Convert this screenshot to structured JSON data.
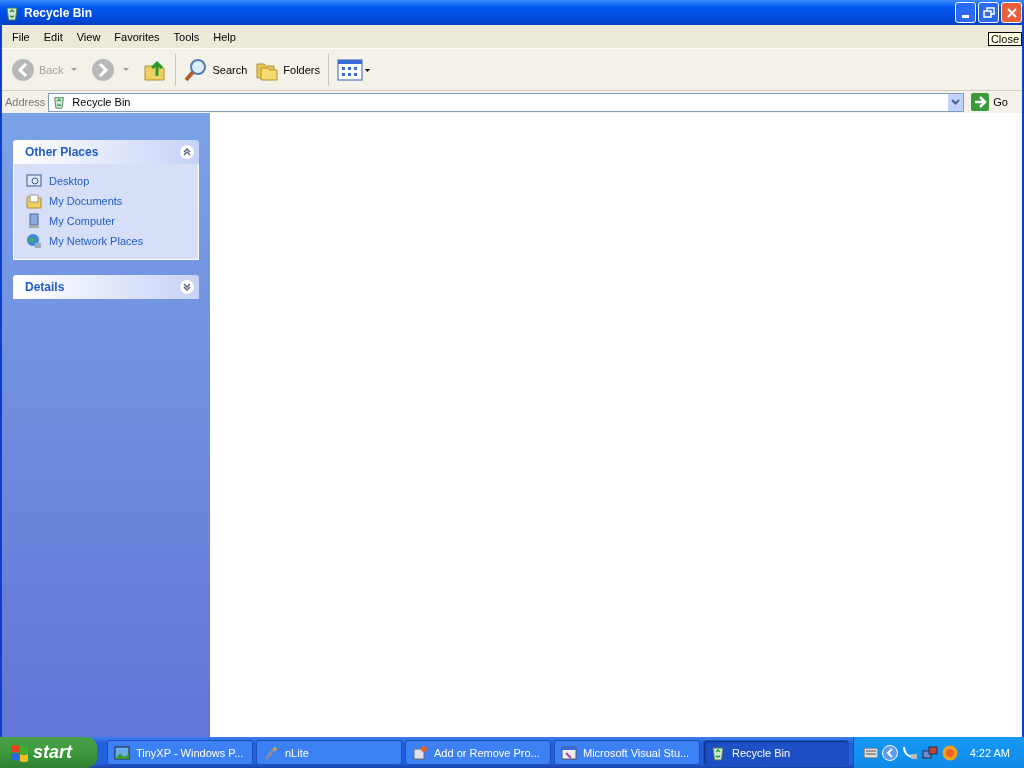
{
  "window": {
    "title": "Recycle Bin"
  },
  "tooltip": "Close",
  "menu": [
    "File",
    "Edit",
    "View",
    "Favorites",
    "Tools",
    "Help"
  ],
  "toolbar": [
    {
      "kind": "back",
      "label": "Back",
      "disabled": true
    },
    {
      "kind": "forward",
      "disabled": true
    },
    {
      "kind": "up",
      "disabled": false
    },
    {
      "kind": "search",
      "label": "Search",
      "disabled": false
    },
    {
      "kind": "folders",
      "label": "Folders",
      "disabled": false
    },
    {
      "kind": "views",
      "disabled": false
    }
  ],
  "address": {
    "label": "Address",
    "value": "Recycle Bin",
    "go": "Go"
  },
  "sidebar": [
    {
      "title": "Other Places",
      "expanded": true,
      "items": [
        {
          "kind": "desktop",
          "label": "Desktop"
        },
        {
          "kind": "documents",
          "label": "My Documents"
        },
        {
          "kind": "computer",
          "label": "My Computer"
        },
        {
          "kind": "network",
          "label": "My Network Places"
        }
      ]
    },
    {
      "title": "Details",
      "expanded": false
    }
  ],
  "taskbar": {
    "start": "start",
    "tasks": [
      {
        "kind": "picture",
        "label": "TinyXP - Windows P...",
        "selected": false
      },
      {
        "kind": "tool",
        "label": "nLite",
        "selected": false
      },
      {
        "kind": "programs",
        "label": "Add or Remove Pro...",
        "selected": false
      },
      {
        "kind": "studio",
        "label": "Microsoft Visual Stu...",
        "selected": false
      },
      {
        "kind": "bin",
        "label": "Recycle Bin",
        "selected": true
      }
    ],
    "clock": "4:22 AM"
  }
}
